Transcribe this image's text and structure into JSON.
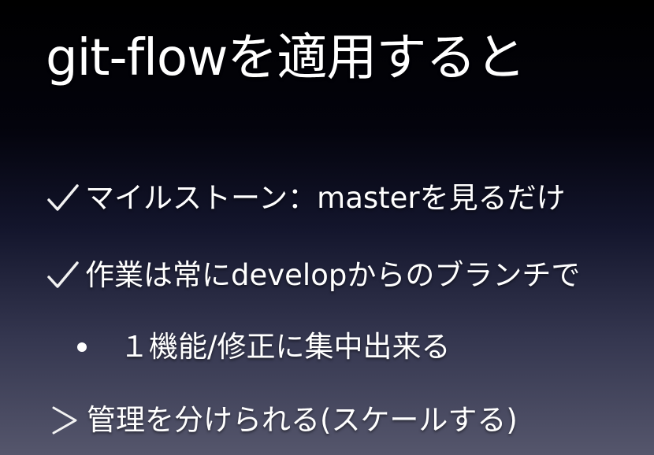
{
  "slide": {
    "title": "git-flowを適用すると",
    "bullets": [
      {
        "marker_icon": "check-icon",
        "text": "マイルストーン：masterを見るだけ"
      },
      {
        "marker_icon": "check-icon",
        "text": "作業は常にdevelopからのブランチで"
      },
      {
        "marker_icon": "bullet-dot-icon",
        "text": "１機能/修正に集中出来る"
      },
      {
        "marker_icon": "chevron-right-icon",
        "text": "管理を分けられる(スケールする)"
      }
    ]
  },
  "colors": {
    "text": "#ffffff",
    "background_top": "#000000",
    "background_bottom": "#55566c"
  }
}
